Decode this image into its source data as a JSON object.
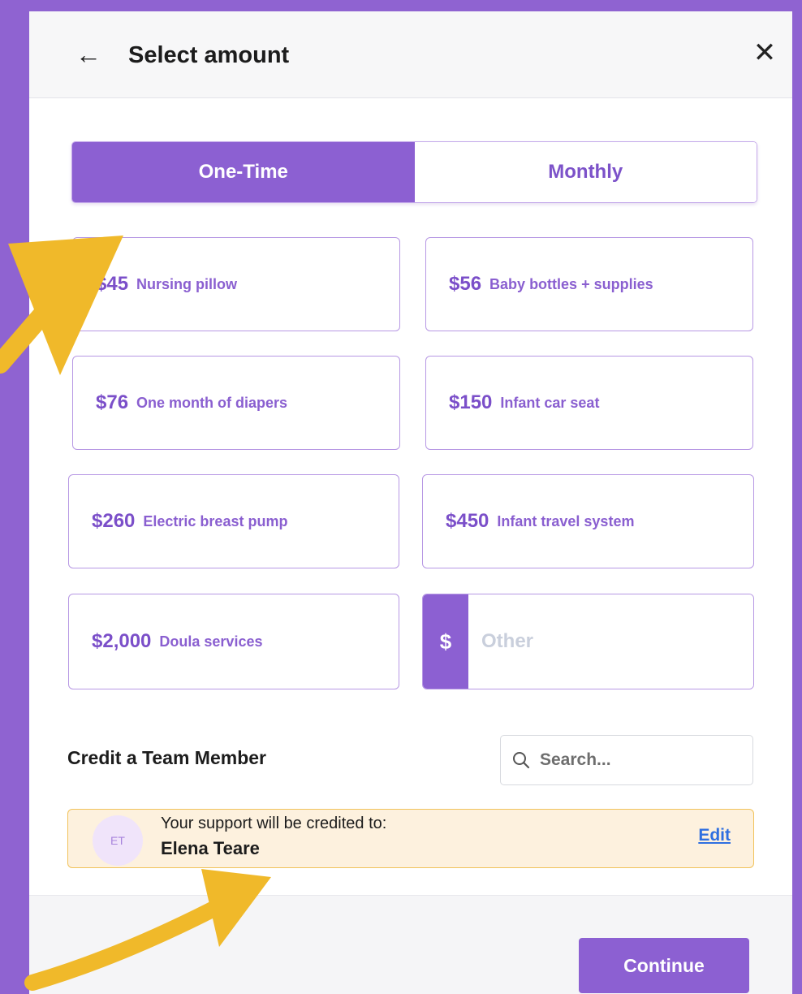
{
  "header": {
    "title": "Select amount",
    "back_icon": "arrow-left-icon",
    "close_icon": "close-icon"
  },
  "frequency": {
    "options": [
      "One-Time",
      "Monthly"
    ],
    "selected": "One-Time"
  },
  "amounts": [
    {
      "amount": "$45",
      "label": "Nursing pillow"
    },
    {
      "amount": "$56",
      "label": "Baby bottles + supplies"
    },
    {
      "amount": "$76",
      "label": "One month of diapers"
    },
    {
      "amount": "$150",
      "label": "Infant car seat"
    },
    {
      "amount": "$260",
      "label": "Electric breast pump"
    },
    {
      "amount": "$450",
      "label": "Infant travel system"
    },
    {
      "amount": "$2,000",
      "label": "Doula services"
    }
  ],
  "other": {
    "currency_symbol": "$",
    "placeholder": "Other"
  },
  "credit": {
    "label": "Credit a Team Member",
    "search_placeholder": "Search...",
    "search_icon": "search-icon",
    "credited_text": "Your support will be credited to:",
    "member_initials": "ET",
    "member_name": "Elena Teare",
    "edit_label": "Edit"
  },
  "footer": {
    "continue_label": "Continue"
  },
  "colors": {
    "background": "#8f63d1",
    "accent": "#8c60d2",
    "annotation_arrow": "#f0b92a",
    "credit_box": "#fdf1de"
  }
}
